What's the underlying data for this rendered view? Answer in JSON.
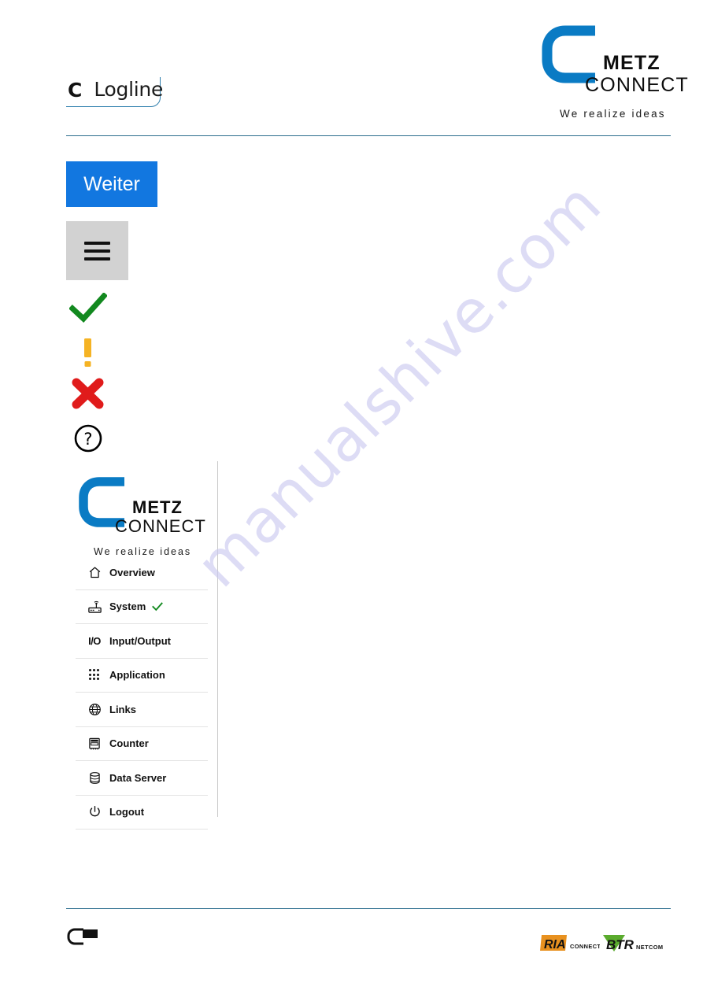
{
  "header": {
    "product_logo": {
      "c_letter": "C",
      "name": "Logline",
      "divider_icon": "vertical-bar-icon"
    },
    "brand_logo": {
      "metz": "METZ",
      "connect": "CONNECT",
      "tagline": "We realize ideas",
      "c_icon": "metz-c-mark-icon"
    }
  },
  "watermark": {
    "text": "manualshive.com"
  },
  "main": {
    "primary_button": {
      "label": "Weiter"
    },
    "menu_button": {
      "icon": "hamburger-menu-icon"
    },
    "status_icons": [
      {
        "name": "check-icon",
        "meaning": "ok",
        "color": "#12891f"
      },
      {
        "name": "exclamation-icon",
        "meaning": "warning",
        "color": "#f5b324"
      },
      {
        "name": "cross-icon",
        "meaning": "error",
        "color": "#e01b1b"
      },
      {
        "name": "question-circle-icon",
        "meaning": "help",
        "color": "#000000"
      }
    ]
  },
  "sidebar": {
    "brand_logo": {
      "metz": "METZ",
      "connect": "CONNECT",
      "tagline": "We realize ideas",
      "c_icon": "metz-c-mark-icon"
    },
    "items": [
      {
        "label": "Overview",
        "icon": "home-icon",
        "status": ""
      },
      {
        "label": "System",
        "icon": "router-icon",
        "status": "check-icon"
      },
      {
        "label": "Input/Output",
        "icon": "io-text-icon",
        "status": ""
      },
      {
        "label": "Application",
        "icon": "grid-dots-icon",
        "status": ""
      },
      {
        "label": "Links",
        "icon": "globe-icon",
        "status": ""
      },
      {
        "label": "Counter",
        "icon": "meter-icon",
        "status": ""
      },
      {
        "label": "Data Server",
        "icon": "database-icon",
        "status": ""
      },
      {
        "label": "Logout",
        "icon": "power-icon",
        "status": ""
      }
    ]
  },
  "footer": {
    "mark_icon": "metz-footer-mark-icon",
    "partners": [
      {
        "name": "RIA",
        "suffix": "CONNECT",
        "color": "#e8911f"
      },
      {
        "name": "BTR",
        "suffix": "NETCOM",
        "color": "#5aab2d"
      }
    ]
  },
  "colors": {
    "brand_blue": "#0a7bc4",
    "rule": "#2d6e8e",
    "button_blue": "#1277e0",
    "menu_gray": "#d2d2d2"
  }
}
